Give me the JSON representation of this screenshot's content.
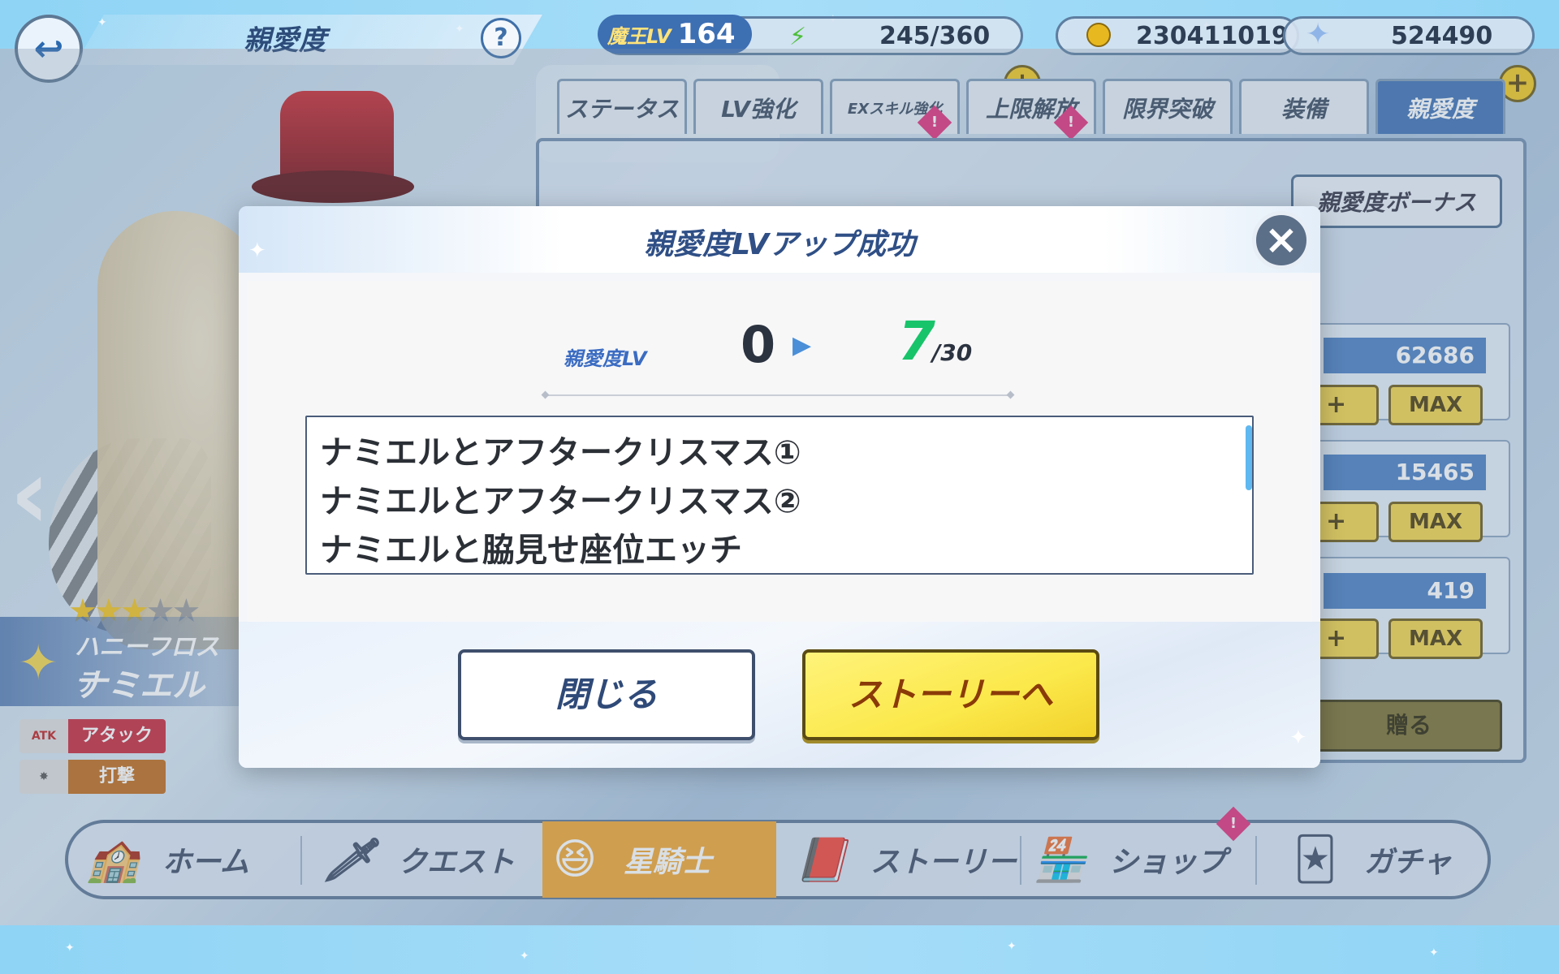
{
  "header": {
    "title": "親愛度",
    "help_label": "?",
    "lv_label": "魔王LV",
    "lv_value": "164",
    "stamina": "245/360",
    "gold": "230411019",
    "gems": "524490",
    "plus_label": "+"
  },
  "tabs": [
    {
      "label": "ステータス"
    },
    {
      "label": "LV強化"
    },
    {
      "label": "EXスキル強化"
    },
    {
      "label": "上限解放"
    },
    {
      "label": "限界突破"
    },
    {
      "label": "装備"
    },
    {
      "label": "親愛度"
    }
  ],
  "side_panel": {
    "bonus_label": "親愛度ボーナス",
    "stats": [
      {
        "value": "62686",
        "plus": "+",
        "max": "MAX"
      },
      {
        "value": "15465",
        "plus": "+",
        "max": "MAX"
      },
      {
        "value": "419",
        "plus": "+",
        "max": "MAX"
      }
    ],
    "give_label": "贈る"
  },
  "character": {
    "stars_filled": 3,
    "stars_total": 5,
    "title": "ハニーフロステ",
    "name": "ナミエル",
    "type_label": "アタック",
    "type_icon": "ATK",
    "attack_label": "打撃"
  },
  "nav": [
    {
      "label": "ホーム",
      "icon": "home-icon"
    },
    {
      "label": "クエスト",
      "icon": "sword-icon"
    },
    {
      "label": "星騎士",
      "icon": "knight-icon"
    },
    {
      "label": "ストーリー",
      "icon": "book-icon"
    },
    {
      "label": "ショップ",
      "icon": "shop-icon"
    },
    {
      "label": "ガチャ",
      "icon": "gacha-card-icon"
    }
  ],
  "modal": {
    "title": "親愛度LVアップ成功",
    "close_icon": "×",
    "lv_label": "親愛度LV",
    "lv_from": "0",
    "lv_to": "7",
    "lv_max": "/30",
    "stories": [
      "ナミエルとアフタークリスマス①",
      "ナミエルとアフタークリスマス②",
      "ナミエルと脇見せ座位エッチ"
    ],
    "close_button": "閉じる",
    "story_button": "ストーリーへ"
  },
  "colors": {
    "accent_blue": "#3d6fb3",
    "level_green": "#17c46a",
    "button_yellow": "#fbe84a",
    "nav_active": "#f2a530"
  }
}
